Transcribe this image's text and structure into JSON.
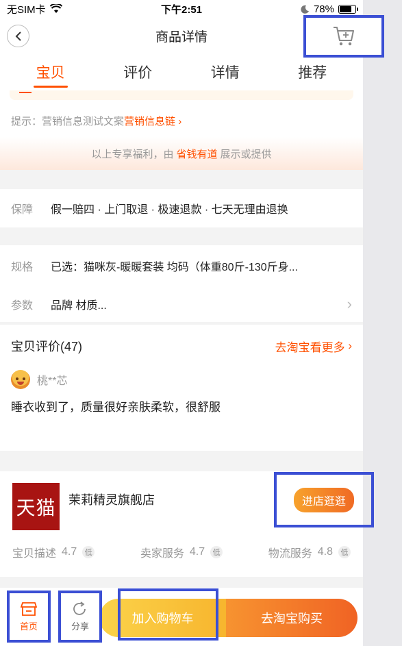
{
  "status_bar": {
    "carrier": "无SIM卡",
    "time": "下午2:51",
    "battery": "78%"
  },
  "nav": {
    "title": "商品详情"
  },
  "tabs": [
    "宝贝",
    "评价",
    "详情",
    "推荐"
  ],
  "tip": {
    "prefix": "提示：营销信息测试文案",
    "link": "营销信息链"
  },
  "welfare": {
    "before": "以上专享福利，由",
    "highlight": "省钱有道",
    "after": "展示或提供"
  },
  "guarantee": {
    "label": "保障",
    "value": "假一赔四 · 上门取退 · 极速退款 · 七天无理由退换"
  },
  "spec": {
    "label": "规格",
    "value": "已选：猫咪灰-暖暖套装 均码（体重80斤-130斤身..."
  },
  "params": {
    "label": "参数",
    "value": "品牌 材质..."
  },
  "reviews": {
    "title": "宝贝评价(47)",
    "more": "去淘宝看更多",
    "reviewer": "桃**芯",
    "text": "睡衣收到了，质量很好亲肤柔软，很舒服"
  },
  "shop": {
    "logo_text": "天猫",
    "name": "茉莉精灵旗舰店",
    "enter_label": "进店逛逛",
    "ratings": [
      {
        "label": "宝贝描述",
        "score": "4.7",
        "level": "低"
      },
      {
        "label": "卖家服务",
        "score": "4.7",
        "level": "低"
      },
      {
        "label": "物流服务",
        "score": "4.8",
        "level": "低"
      }
    ]
  },
  "bottom": {
    "home": "首页",
    "share": "分享",
    "add_cart": "加入购物车",
    "buy": "去淘宝购买"
  },
  "colors": {
    "accent": "#ff5000",
    "highlight_box": "#3b4fd4"
  }
}
